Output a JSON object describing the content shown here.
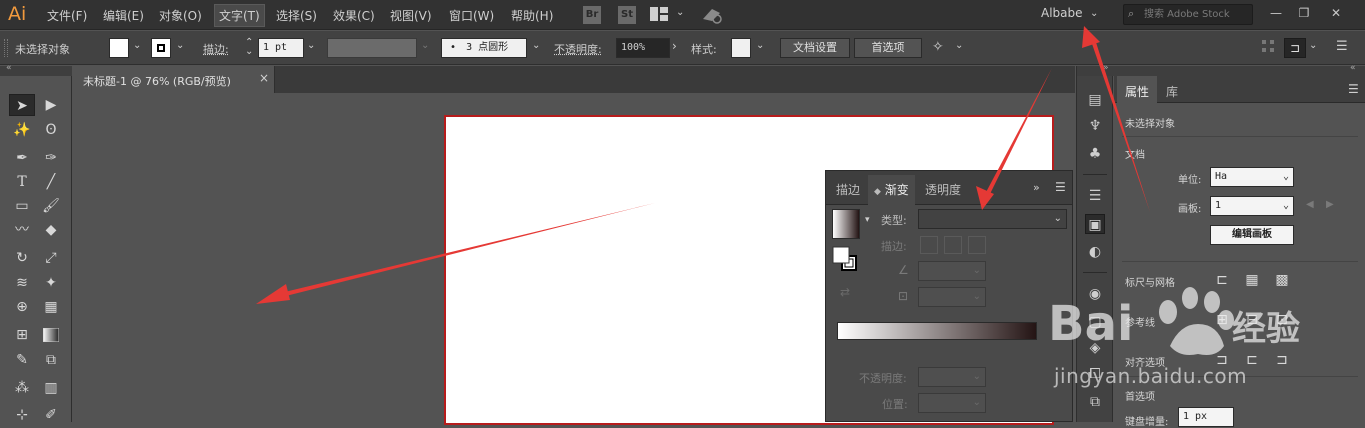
{
  "menubar": {
    "logo": "Ai",
    "items": [
      "文件(F)",
      "编辑(E)",
      "对象(O)",
      "文字(T)",
      "选择(S)",
      "效果(C)",
      "视图(V)",
      "窗口(W)",
      "帮助(H)"
    ],
    "bridge_icon": "Br",
    "stock_icon": "St",
    "workspace": "Albabe",
    "search_placeholder": "搜索 Adobe Stock"
  },
  "controlbar": {
    "selection": "未选择对象",
    "stroke_label": "描边:",
    "stroke_value": "1 pt",
    "brush_value": "3 点圆形",
    "opacity_label": "不透明度:",
    "opacity_value": "100%",
    "style_label": "样式:",
    "doc_setup_button": "文档设置",
    "preferences_button": "首选项"
  },
  "document": {
    "tab_title": "未标题-1 @ 76% (RGB/预览)",
    "tab_close": "×"
  },
  "gradient_panel": {
    "tabs": [
      "描边",
      "渐变",
      "透明度"
    ],
    "active_tab": "渐变",
    "type_label": "类型:",
    "stroke_label": "描边:",
    "opacity_label": "不透明度:",
    "location_label": "位置:",
    "gradient_start": "#ffffff",
    "gradient_end": "#241414"
  },
  "properties_panel": {
    "tabs": [
      "属性",
      "库"
    ],
    "active_tab": "属性",
    "no_selection": "未选择对象",
    "document_section": "文档",
    "units_label": "单位:",
    "units_value": "Ha",
    "artboard_label": "画板:",
    "artboard_value": "1",
    "edit_artboards_button": "编辑画板",
    "rulers_grids_label": "标尺与网格",
    "guides_label": "参考线",
    "snap_options_label": "对齐选项",
    "preferences_label": "首选项",
    "keyboard_increment_label": "键盘增量:",
    "keyboard_increment_value": "1 px"
  },
  "watermark": {
    "brand": "Baidu 经验",
    "url": "jingyan.baidu.com"
  },
  "colors": {
    "annotation_arrow": "#e53935",
    "artboard_border": "#b71c1c",
    "logo": "#f29a3d"
  }
}
